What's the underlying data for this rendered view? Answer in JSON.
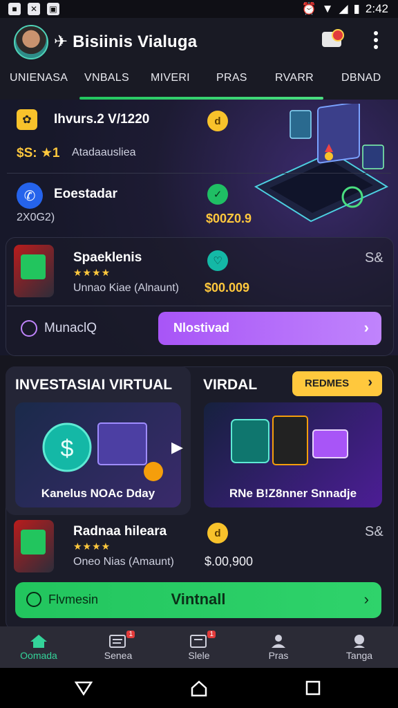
{
  "status_bar": {
    "time": "2:42",
    "left_icons": [
      "notification-icon",
      "close-notification-icon",
      "message-icon"
    ],
    "right_icons": [
      "alarm-icon",
      "wifi-icon",
      "signal-icon",
      "battery-icon"
    ]
  },
  "app_bar": {
    "title": "✈ Bisiinis Vialuga",
    "notification_icon": "notification-badge-icon",
    "more_icon": "more-vert-icon"
  },
  "tabs": [
    {
      "label": "UNIENASA"
    },
    {
      "label": "VNBALS"
    },
    {
      "label": "MIVERI"
    },
    {
      "label": "PRAS"
    },
    {
      "label": "RVARR"
    },
    {
      "label": "DBNAD"
    }
  ],
  "items": [
    {
      "title": "Ihvurs.2 V/1220",
      "subtitle_rating": "$S: ★1",
      "subtitle": "Atadaausliea",
      "coin_icon": "d",
      "price": ""
    },
    {
      "title": "Eoestadar",
      "subtitle": "2X0G2)",
      "price": "$00Z0.9",
      "coin_icon": "✓"
    },
    {
      "title": "Spaeklenis",
      "stars": "★★★★",
      "subtitle": "Unnao Kiae (Alnaunt)",
      "price": "$00.009",
      "coin_icon": "♡",
      "trailing": "S&"
    }
  ],
  "card_actions": {
    "link_label": "MunaclQ",
    "button_label": "Nlostivad",
    "button_chevron": "›"
  },
  "section2": {
    "left_title": "INVESTASIAI VIRTUAL",
    "right_title": "VIRDAL",
    "badge_label": "REDMES",
    "badge_chevron": "›",
    "thumb_left_caption": "Kanelus NOAc Dday",
    "thumb_right_caption": "RNe B!Z8nner Snnadje"
  },
  "item4": {
    "title": "Radnaa hileara",
    "stars": "★★★★",
    "subtitle": "Oneo Nias (Amaunt)",
    "price": "$.00,900",
    "coin_icon": "d",
    "trailing": "S&"
  },
  "green_button": {
    "left_label": "Flvmesin",
    "center_label": "Vintnall",
    "chevron": "›"
  },
  "bottom_nav": [
    {
      "label": "Oomada",
      "icon": "home-icon",
      "active": true
    },
    {
      "label": "Senea",
      "icon": "inbox-icon",
      "badge": "1"
    },
    {
      "label": "Slele",
      "icon": "card-icon",
      "badge": "1"
    },
    {
      "label": "Pras",
      "icon": "person-icon"
    },
    {
      "label": "Tanga",
      "icon": "profile-icon"
    }
  ],
  "colors": {
    "accent_green": "#22c55e",
    "accent_purple": "#a855f7",
    "accent_yellow": "#ffc83d",
    "background": "#16161f"
  }
}
